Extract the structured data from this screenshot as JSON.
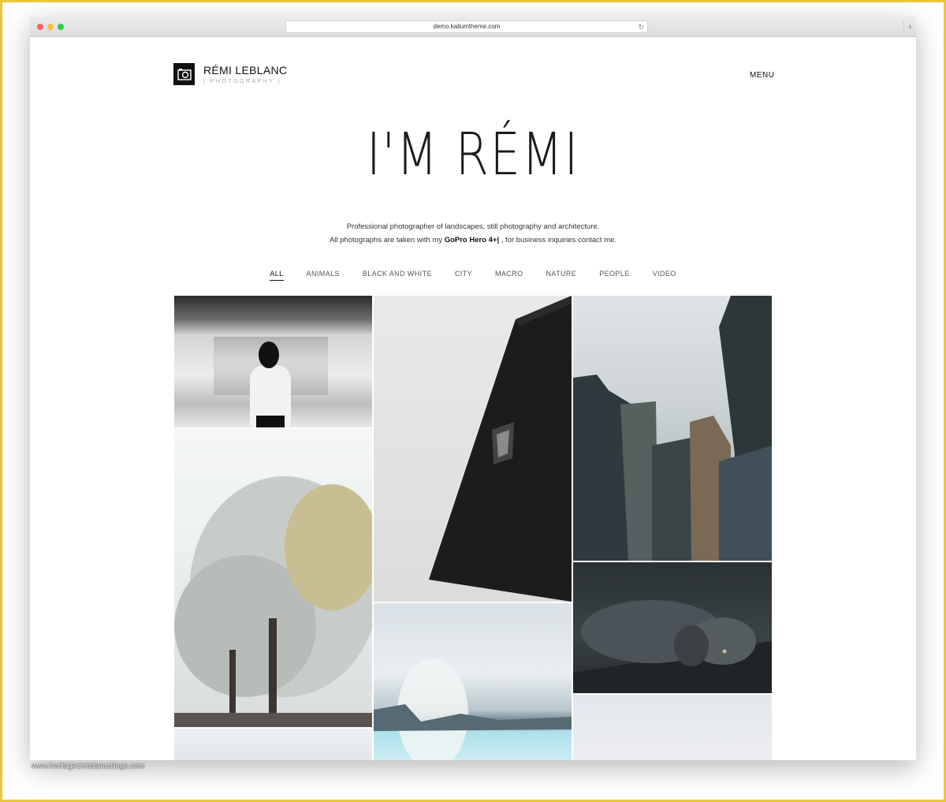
{
  "browser": {
    "url": "demo.kaliumtheme.com",
    "reload_icon": "reload-icon",
    "new_tab_label": "+"
  },
  "header": {
    "brand_name": "RÉMI LEBLANC",
    "brand_sub": "| PHOTOGRAPHY |",
    "menu_label": "MENU"
  },
  "hero": {
    "title": "I'M RÉMI",
    "intro_line1": "Professional photographer of landscapes, still photography and architecture.",
    "intro_line2_pre": "All photographs are taken with my",
    "intro_line2_bold": "GoPro Hero 4+|",
    "intro_line2_post": ", for business inquiries contact me."
  },
  "filters": [
    "ALL",
    "ANIMALS",
    "BLACK AND WHITE",
    "CITY",
    "MACRO",
    "NATURE",
    "PEOPLE",
    "VIDEO"
  ],
  "active_filter": "ALL",
  "watermark": "www.heritagechristiancollege.com",
  "colors": {
    "border": "#e8c63c",
    "text": "#111111"
  }
}
